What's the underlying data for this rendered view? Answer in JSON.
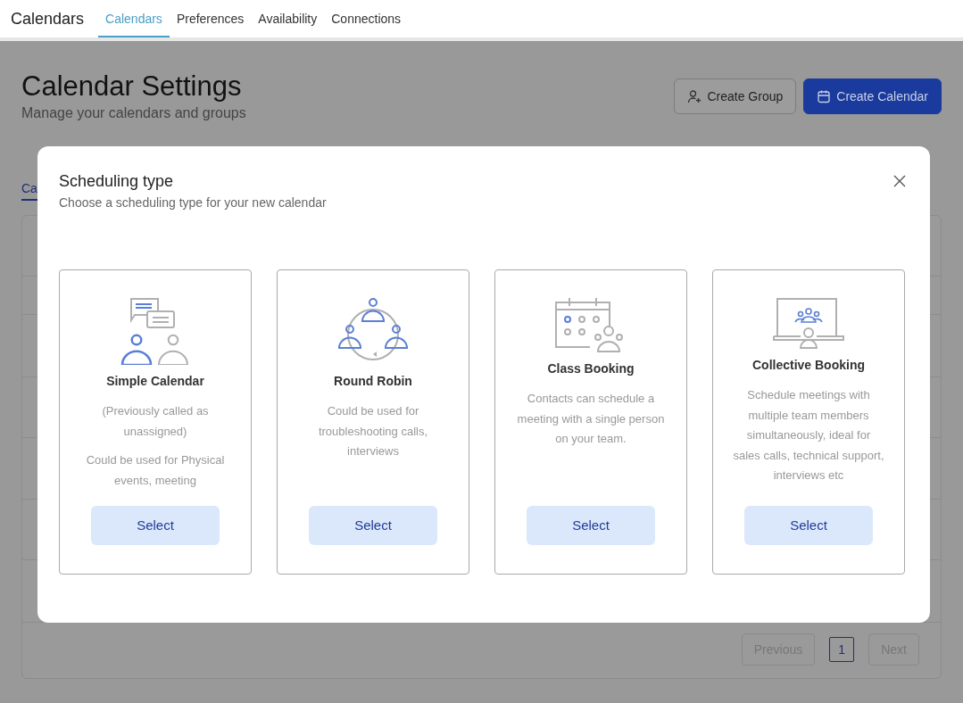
{
  "topbar": {
    "brand": "Calendars",
    "tabs": [
      {
        "label": "Calendars",
        "selected": true
      },
      {
        "label": "Preferences",
        "selected": false
      },
      {
        "label": "Availability",
        "selected": false
      },
      {
        "label": "Connections",
        "selected": false
      }
    ]
  },
  "page": {
    "title": "Calendar Settings",
    "subtitle": "Manage your calendars and groups",
    "buttons": [
      {
        "label": "Create Group",
        "kind": "outline"
      },
      {
        "label": "Create Calendar",
        "kind": "primary"
      }
    ],
    "tab_fragment": "Ca",
    "pagination": {
      "previous": "Previous",
      "pages": [
        {
          "label": "1",
          "selected": true
        }
      ],
      "next": "Next"
    }
  },
  "modal": {
    "title": "Scheduling type",
    "subtitle": "Choose a scheduling type for your new calendar",
    "options": [
      {
        "kind": "simple",
        "title": "Simple Calendar",
        "description": [
          "(Previously called as unassigned)",
          "Could be used for Physical events, meeting"
        ],
        "button": "Select"
      },
      {
        "kind": "round_robin",
        "title": "Round Robin",
        "description": [
          "Could be used for troubleshooting calls, interviews"
        ],
        "button": "Select"
      },
      {
        "kind": "class",
        "title": "Class Booking",
        "description": [
          "Contacts can schedule a meeting with a single person on your team."
        ],
        "button": "Select"
      },
      {
        "kind": "collective",
        "title": "Collective Booking",
        "description": [
          "Schedule meetings with multiple team members simultaneously, ideal for sales calls, technical support, interviews etc"
        ],
        "button": "Select"
      }
    ]
  }
}
